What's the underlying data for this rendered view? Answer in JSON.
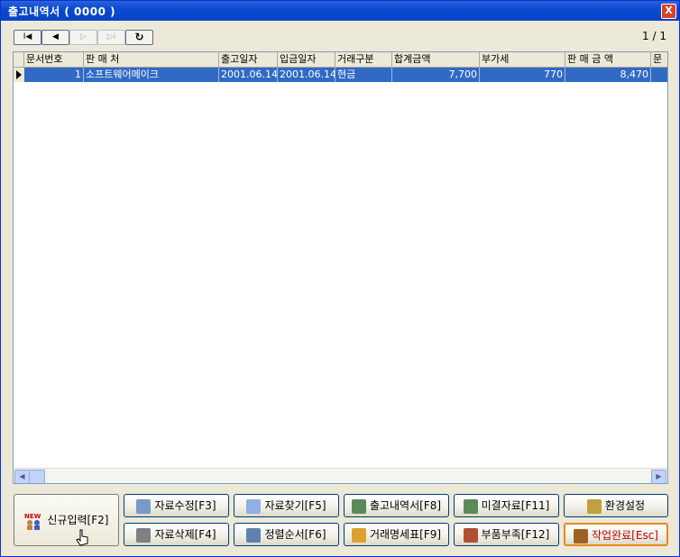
{
  "window": {
    "title": "출고내역서 ( 0000 )",
    "close_label": "X"
  },
  "nav": {
    "first": "I◀",
    "prev": "◀",
    "next": "▷",
    "last": "▷I",
    "refresh": "↻",
    "page_indicator": "1 / 1"
  },
  "grid": {
    "columns": [
      "문서번호",
      "판 매 처",
      "출고일자",
      "입금일자",
      "거래구분",
      "합계금액",
      "부가세",
      "판 매 금 액",
      "문"
    ],
    "rows": [
      {
        "doc_no": "1",
        "buyer": "소프트웨어메이크",
        "ship_date": "2001.06.14",
        "pay_date": "2001.06.14",
        "trade_type": "현금",
        "total": "7,700",
        "vat": "770",
        "sale_amount": "8,470"
      }
    ]
  },
  "buttons": {
    "new": "신규입력[F2]",
    "new_badge": "NEW",
    "edit": "자료수정[F3]",
    "search": "자료찾기[F5]",
    "ship_list": "출고내역서[F8]",
    "unsettled": "미결자료[F11]",
    "settings": "환경설정",
    "delete": "자료삭제[F4]",
    "sort": "정렬순서[F6]",
    "statement": "거래명세표[F9]",
    "parts": "부품부족[F12]",
    "done": "작업완료[Esc]"
  }
}
